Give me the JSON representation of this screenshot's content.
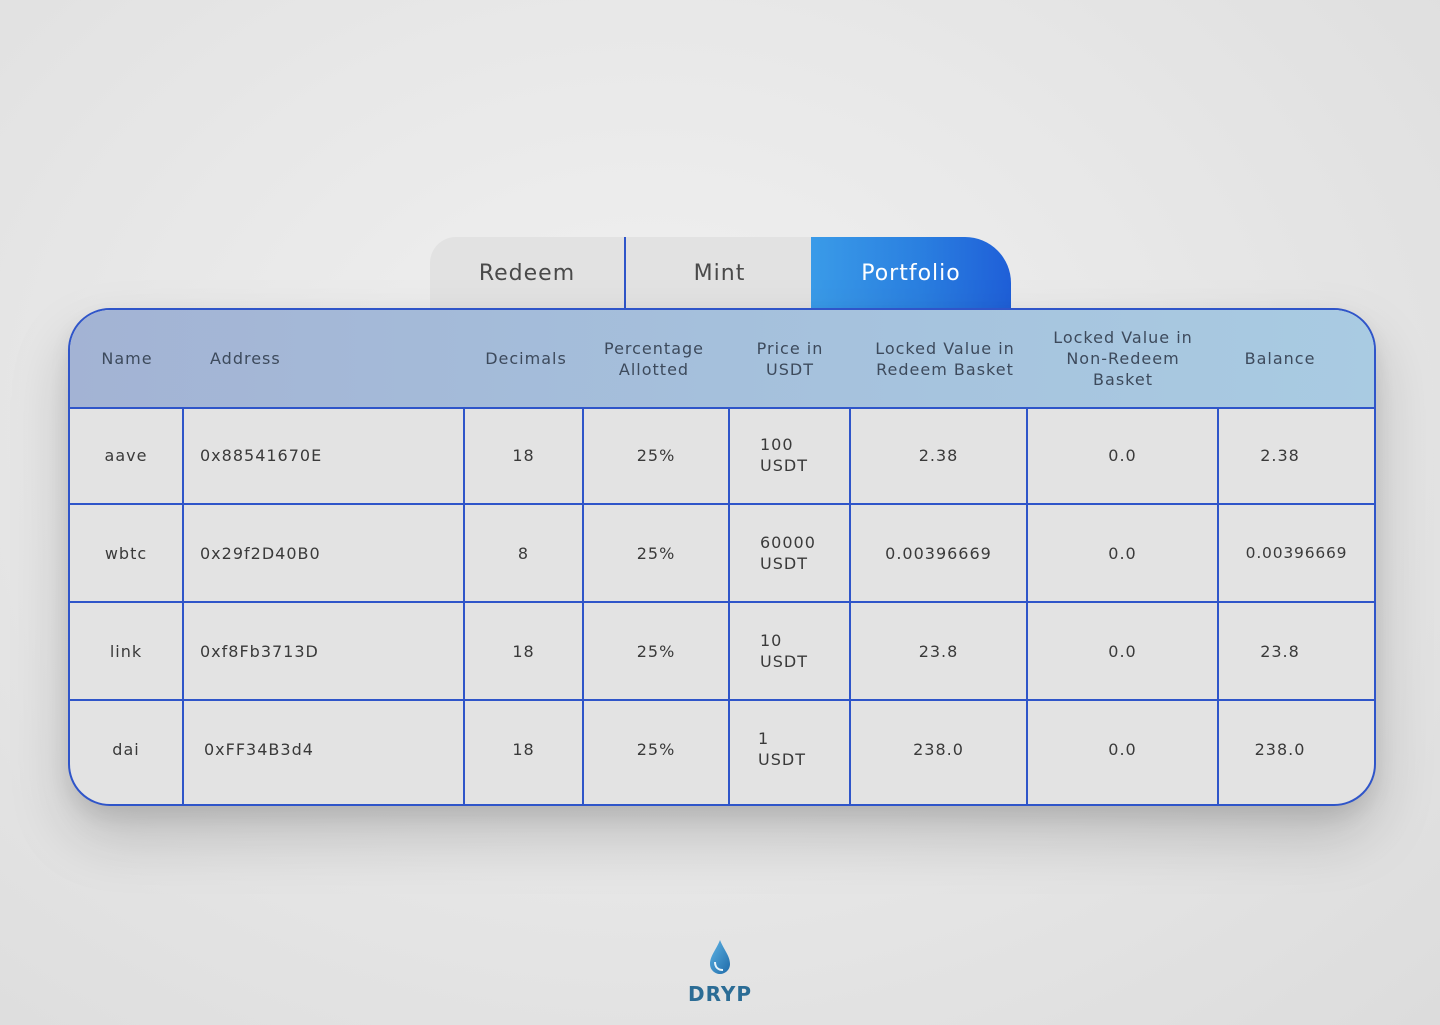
{
  "tabs": [
    {
      "label": "Redeem"
    },
    {
      "label": "Mint"
    },
    {
      "label": "Portfolio",
      "active": true
    }
  ],
  "table": {
    "columns": [
      "Name",
      "Address",
      "Decimals",
      "Percentage Allotted",
      "Price in USDT",
      "Locked Value in Redeem Basket",
      "Locked Value in Non-Redeem Basket",
      "Balance"
    ],
    "rows": [
      {
        "name": "aave",
        "address": "0x88541670E",
        "decimals": "18",
        "percentage": "25%",
        "price": "100 USDT",
        "locked_redeem": "2.38",
        "locked_non_redeem": "0.0",
        "balance": "2.38"
      },
      {
        "name": "wbtc",
        "address": "0x29f2D40B0",
        "decimals": "8",
        "percentage": "25%",
        "price": "60000 USDT",
        "locked_redeem": "0.00396669",
        "locked_non_redeem": "0.0",
        "balance": "0.00396669"
      },
      {
        "name": "link",
        "address": "0xf8Fb3713D",
        "decimals": "18",
        "percentage": "25%",
        "price": "10 USDT",
        "locked_redeem": "23.8",
        "locked_non_redeem": "0.0",
        "balance": "23.8"
      },
      {
        "name": "dai",
        "address": "0xFF34B3d4",
        "decimals": "18",
        "percentage": "25%",
        "price": "1 USDT",
        "locked_redeem": "238.0",
        "locked_non_redeem": "0.0",
        "balance": "238.0"
      }
    ]
  },
  "brand": {
    "name": "DRYP",
    "icon": "water-drop-icon",
    "color": "#2b6c95"
  },
  "colors": {
    "accent": "#2f55c9",
    "tab_active_start": "#3a9be8",
    "tab_active_end": "#1f5fd8"
  }
}
